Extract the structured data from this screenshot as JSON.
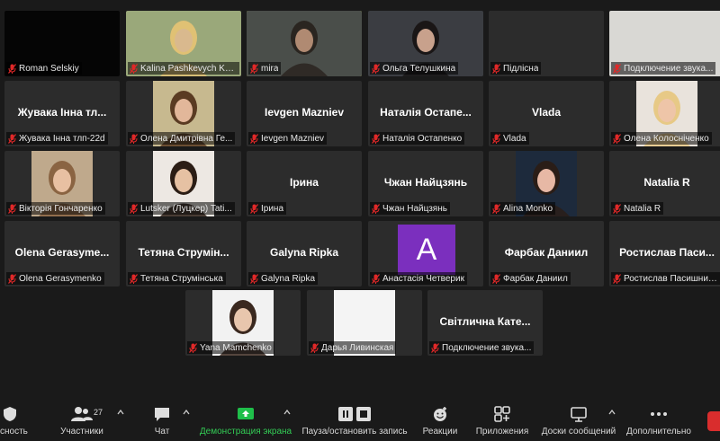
{
  "colors": {
    "background": "#1a1a1a",
    "tile": "#2c2c2c",
    "active_border": "#d6e64a",
    "muted_mic": "#e02828",
    "share_green": "#33cc55",
    "avatar_bg": "#7b2fbe"
  },
  "participants": [
    {
      "name": "Roman Selskiy"
    },
    {
      "name": "Kalina Pashkevych KNUT..."
    },
    {
      "name": "mira"
    },
    {
      "name": "Ольга Телушкина"
    },
    {
      "name": "Підлісна"
    },
    {
      "name": "Подключение звука..."
    },
    {
      "name": "Жувака Інна тлп-22d",
      "display": "Жувака Інна тл..."
    },
    {
      "name": "Олена Дмитрівна Ге..."
    },
    {
      "name": "Ievgen Mazniev",
      "display": "Ievgen Mazniev"
    },
    {
      "name": "Наталія Остапенко",
      "display": "Наталія Остапе..."
    },
    {
      "name": "Vlada",
      "display": "Vlada"
    },
    {
      "name": "Олена Колосніченко"
    },
    {
      "name": "Вікторія Гончаренко"
    },
    {
      "name": "Lutsker (Луцкер) Tati..."
    },
    {
      "name": "Ірина",
      "display": "Ірина"
    },
    {
      "name": "Чжан Найцзянь",
      "display": "Чжан Найцзянь"
    },
    {
      "name": "Alina Monko"
    },
    {
      "name": "Natalia R",
      "display": "Natalia R"
    },
    {
      "name": "Olena Gerasymenko",
      "display": "Olena Gerasyme..."
    },
    {
      "name": "Тетяна Струмінська",
      "display": "Тетяна Струмін..."
    },
    {
      "name": "Galyna Ripka",
      "display": "Galyna Ripka"
    },
    {
      "name": "Анастасія Четверик",
      "avatar_letter": "A"
    },
    {
      "name": "Фарбак Даниил",
      "display": "Фарбак Даниил"
    },
    {
      "name": "Ростислав Пасишниченко",
      "display": "Ростислав Паси..."
    },
    {
      "name": "Yana Mamchenko"
    },
    {
      "name": "Дарья Ливинская"
    },
    {
      "name": "Подключение звука...",
      "display": "Світлична Кате..."
    }
  ],
  "toolbar": {
    "security": "сность",
    "participants": "Участники",
    "participants_count": "27",
    "chat": "Чат",
    "share": "Демонстрация экрана",
    "record": "Пауза/остановить запись",
    "reactions": "Реакции",
    "apps": "Приложения",
    "whiteboards": "Доски сообщений",
    "more": "Дополнительно"
  }
}
